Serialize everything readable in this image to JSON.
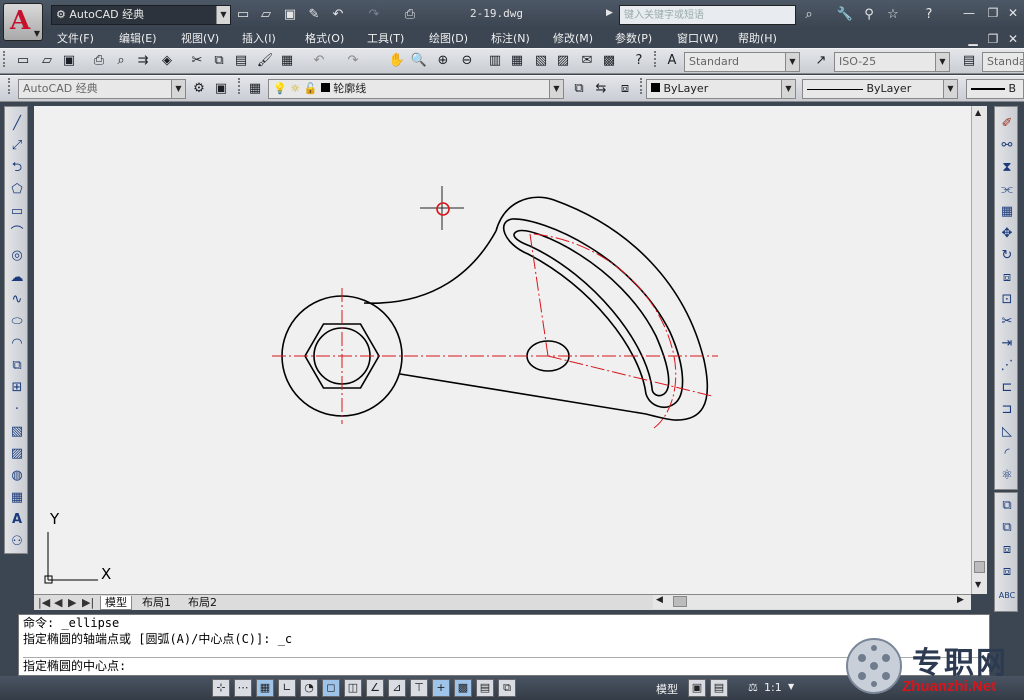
{
  "titlebar": {
    "workspace": "AutoCAD 经典",
    "document": "2-19.dwg",
    "search_placeholder": "键入关键字或短语",
    "icons": [
      "new-icon",
      "open-icon",
      "save-icon",
      "saveas-icon",
      "undo-icon",
      "redo-icon",
      "plot-icon",
      "binoculars-icon",
      "wrench-icon",
      "satellite-icon",
      "star-icon",
      "help-icon",
      "minimize-icon",
      "restore-icon",
      "close-icon"
    ]
  },
  "menu": [
    "文件(F)",
    "编辑(E)",
    "视图(V)",
    "插入(I)",
    "格式(O)",
    "工具(T)",
    "绘图(D)",
    "标注(N)",
    "修改(M)",
    "参数(P)",
    "窗口(W)",
    "帮助(H)"
  ],
  "styles": {
    "text_style": "Standard",
    "dim_style": "ISO-25",
    "table_style": "Standa"
  },
  "workspace_combo": "AutoCAD 经典",
  "layer": {
    "name": "轮廓线",
    "color": "#000000"
  },
  "properties": {
    "color": "ByLayer",
    "linetype": "ByLayer",
    "lineweight_partial": "B"
  },
  "tabs": [
    "模型",
    "布局1",
    "布局2"
  ],
  "command": {
    "line1": "命令:  _ellipse",
    "line2": "指定椭圆的轴端点或 [圆弧(A)/中心点(C)]: _c",
    "prompt": "指定椭圆的中心点:"
  },
  "ucs": {
    "x": "X",
    "y": "Y"
  },
  "status": {
    "model": "模型",
    "scale": "1:1"
  },
  "watermark": {
    "brand": "专职网",
    "url": "Zhuanzhi.Net"
  },
  "colors": {
    "drawing_line": "#000000",
    "center_line": "#d9141b",
    "canvas": "#f0f0f0"
  }
}
